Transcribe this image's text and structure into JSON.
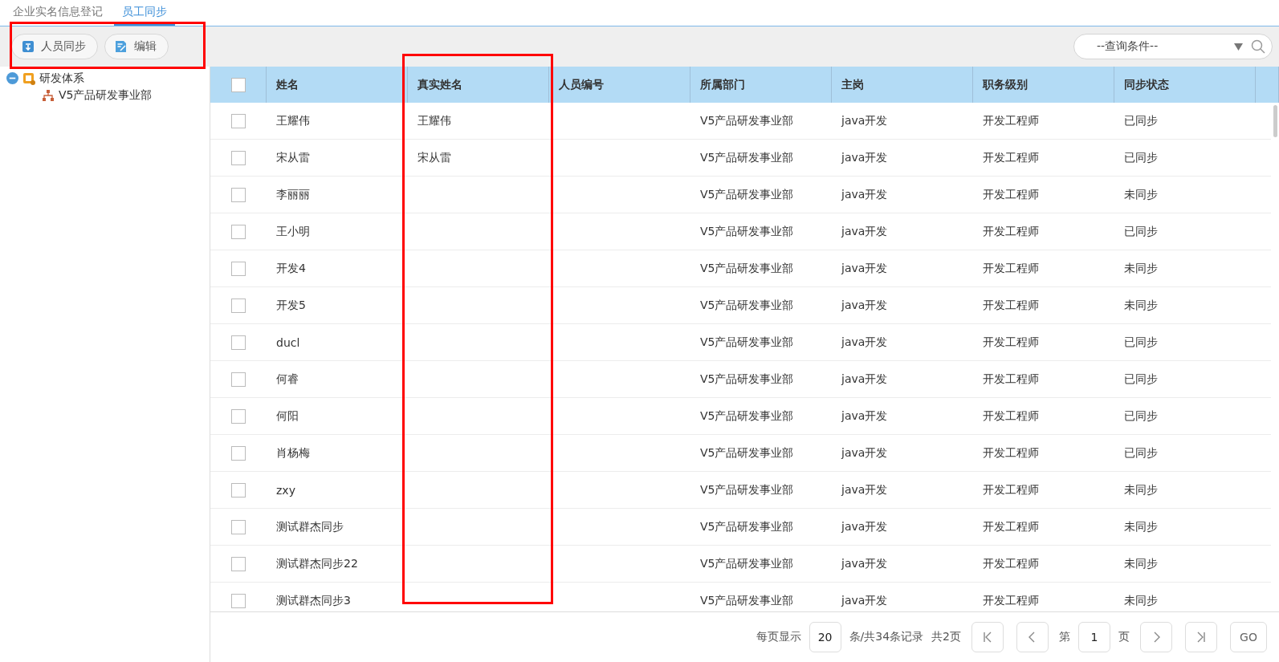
{
  "tabs": [
    {
      "label": "企业实名信息登记",
      "selected": false
    },
    {
      "label": "员工同步",
      "selected": true
    }
  ],
  "toolbar": {
    "buttons": [
      {
        "label": "人员同步",
        "kind": "sync"
      },
      {
        "label": "编辑",
        "kind": "edit"
      }
    ],
    "query": {
      "placeholder": "--查询条件--"
    }
  },
  "tree": [
    {
      "label": "研发体系",
      "expanded": true,
      "children": [
        {
          "label": "V5产品研发事业部"
        }
      ]
    }
  ],
  "table": {
    "header_checked": false,
    "columns": [
      "姓名",
      "真实姓名",
      "人员编号",
      "所属部门",
      "主岗",
      "职务级别",
      "同步状态"
    ],
    "rows": [
      {
        "checked": false,
        "cells": [
          "王耀伟",
          "王耀伟",
          "",
          "V5产品研发事业部",
          "java开发",
          "开发工程师",
          "已同步"
        ]
      },
      {
        "checked": false,
        "cells": [
          "宋从雷",
          "宋从雷",
          "",
          "V5产品研发事业部",
          "java开发",
          "开发工程师",
          "已同步"
        ]
      },
      {
        "checked": false,
        "cells": [
          "李丽丽",
          "",
          "",
          "V5产品研发事业部",
          "java开发",
          "开发工程师",
          "未同步"
        ]
      },
      {
        "checked": false,
        "cells": [
          "王小明",
          "",
          "",
          "V5产品研发事业部",
          "java开发",
          "开发工程师",
          "已同步"
        ]
      },
      {
        "checked": false,
        "cells": [
          "开发4",
          "",
          "",
          "V5产品研发事业部",
          "java开发",
          "开发工程师",
          "未同步"
        ]
      },
      {
        "checked": false,
        "cells": [
          "开发5",
          "",
          "",
          "V5产品研发事业部",
          "java开发",
          "开发工程师",
          "未同步"
        ]
      },
      {
        "checked": false,
        "cells": [
          "ducl",
          "",
          "",
          "V5产品研发事业部",
          "java开发",
          "开发工程师",
          "已同步"
        ]
      },
      {
        "checked": false,
        "cells": [
          "何睿",
          "",
          "",
          "V5产品研发事业部",
          "java开发",
          "开发工程师",
          "已同步"
        ]
      },
      {
        "checked": false,
        "cells": [
          "何阳",
          "",
          "",
          "V5产品研发事业部",
          "java开发",
          "开发工程师",
          "已同步"
        ]
      },
      {
        "checked": false,
        "cells": [
          "肖杨梅",
          "",
          "",
          "V5产品研发事业部",
          "java开发",
          "开发工程师",
          "已同步"
        ]
      },
      {
        "checked": false,
        "cells": [
          "zxy",
          "",
          "",
          "V5产品研发事业部",
          "java开发",
          "开发工程师",
          "未同步"
        ]
      },
      {
        "checked": false,
        "cells": [
          "测试群杰同步",
          "",
          "",
          "V5产品研发事业部",
          "java开发",
          "开发工程师",
          "未同步"
        ]
      },
      {
        "checked": false,
        "cells": [
          "测试群杰同步22",
          "",
          "",
          "V5产品研发事业部",
          "java开发",
          "开发工程师",
          "未同步"
        ]
      },
      {
        "checked": false,
        "cells": [
          "测试群杰同步3",
          "",
          "",
          "V5产品研发事业部",
          "java开发",
          "开发工程师",
          "未同步"
        ]
      }
    ]
  },
  "pagination": {
    "per_page_label": "每页显示",
    "per_page": "20",
    "records": "条/共34条记录",
    "pages": "共2页",
    "page_prefix": "第",
    "page": "1",
    "page_suffix": "页",
    "go": "GO"
  }
}
